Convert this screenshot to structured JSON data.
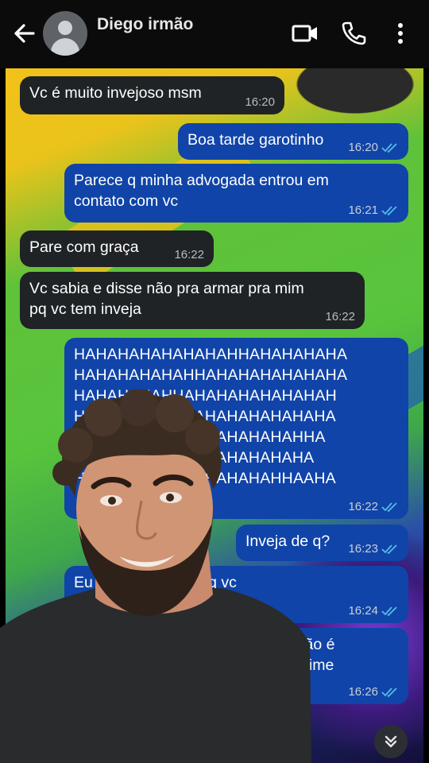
{
  "header": {
    "contact_name": "Diego irmão",
    "icons": [
      "back-arrow-icon",
      "avatar-icon",
      "video-call-icon",
      "phone-icon",
      "more-vert-icon"
    ]
  },
  "messages": [
    {
      "dir": "in",
      "text": "Vc é muito invejoso msm",
      "time": "16:20"
    },
    {
      "dir": "out",
      "text": "Boa tarde garotinho",
      "time": "16:20"
    },
    {
      "dir": "out",
      "text": "Parece q minha advogada entrou em\ncontato com vc",
      "time": "16:21"
    },
    {
      "dir": "in",
      "text": "Pare com graça",
      "time": "16:22"
    },
    {
      "dir": "in",
      "text": "Vc sabia e disse não pra armar pra mim\npq vc tem inveja",
      "time": "16:22"
    },
    {
      "dir": "out",
      "text": "HAHAHAHAHAHAHAHHAHAHAHAHA\nHAHAHAHAHAHHAHAHAHAHAHAHA\nHAHAHAHAHHAHAHAHAHAHAHAH\nHAHAHAHAHAHAHAHAHAHAHAHA\nHAHAHAHAHAHAHAHAHAHAHHA\nHAHAHAHAHAHAHAHAHAHAHA\nHAHAHAHAHAHAHAHAHAHHAAHA",
      "time": "16:22"
    },
    {
      "dir": "out",
      "text": "Inveja de q?",
      "time": "16:23"
    },
    {
      "dir": "out",
      "text": "Eu ... a advogada pq vc\nc...",
      "time": "16:24"
    },
    {
      "dir": "out",
      "text": "... não é\n... crime",
      "time": "16:26"
    }
  ],
  "colors": {
    "incoming_bubble": "#1f2326",
    "outgoing_bubble": "#1044a8",
    "read_ticks": "#53bdeb"
  }
}
